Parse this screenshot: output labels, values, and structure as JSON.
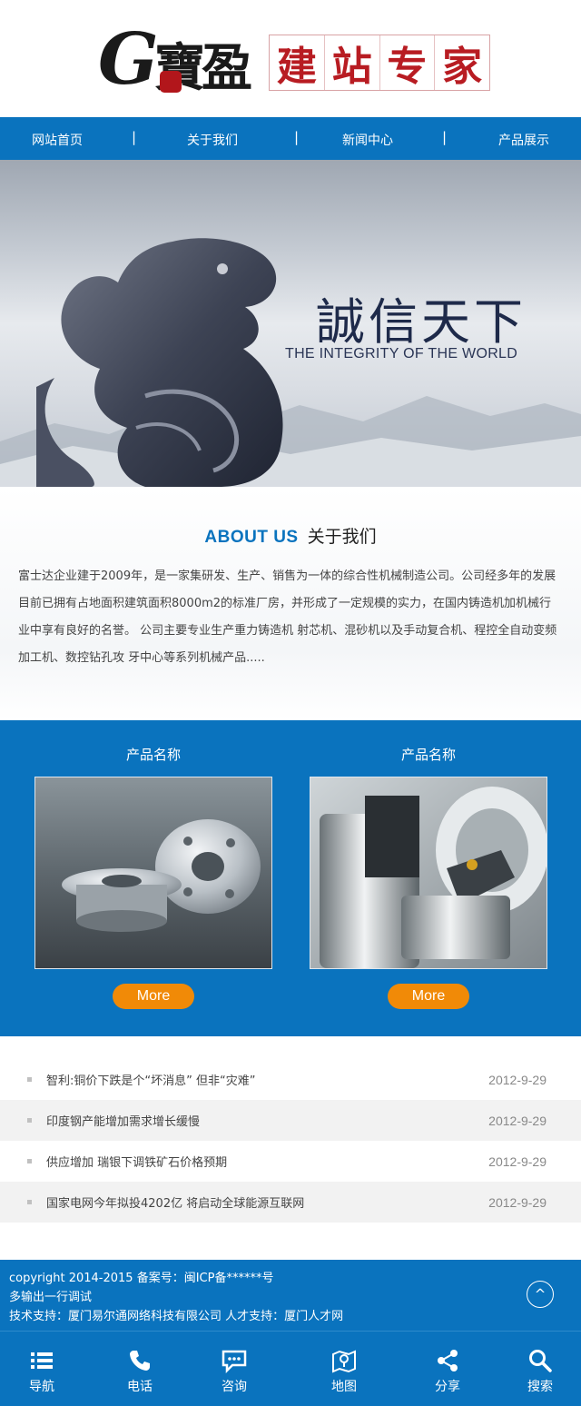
{
  "header": {
    "logo_g": "G",
    "logo_name": "寶盈",
    "logo_slogan_chars": [
      "建",
      "站",
      "专",
      "家"
    ]
  },
  "nav": {
    "items": [
      "网站首页",
      "关于我们",
      "新闻中心",
      "产品展示"
    ],
    "separator": "|"
  },
  "banner": {
    "slogan_zh": "誠信天下",
    "slogan_en": "THE INTEGRITY OF THE WORLD"
  },
  "about": {
    "title_en": "ABOUT US",
    "title_zh": "关于我们",
    "text": "富士达企业建于2009年，是一家集研发、生产、销售为一体的综合性机械制造公司。公司经多年的发展目前已拥有占地面积建筑面积8000m2的标准厂房，并形成了一定规模的实力，在国内铸造机加机械行业中享有良好的名誉。 公司主要专业生产重力铸造机 射芯机、混砂机以及手动复合机、程控全自动变频加工机、数控钻孔攻 牙中心等系列机械产品....."
  },
  "products": [
    {
      "name": "产品名称",
      "more": "More"
    },
    {
      "name": "产品名称",
      "more": "More"
    }
  ],
  "news": [
    {
      "title": "智利:铜价下跌是个“坏消息” 但非“灾难”",
      "date": "2012-9-29"
    },
    {
      "title": "印度钢产能增加需求增长缓慢",
      "date": "2012-9-29"
    },
    {
      "title": "供应增加 瑞银下调铁矿石价格预期",
      "date": "2012-9-29"
    },
    {
      "title": "国家电网今年拟投4202亿 将启动全球能源互联网",
      "date": "2012-9-29"
    }
  ],
  "footer": {
    "line1": "copyright 2014-2015 备案号：闽ICP备******号",
    "line2": "多输出一行调试",
    "line3": "技术支持：厦门易尔通网络科技有限公司 人才支持：厦门人才网",
    "up_icon": "^"
  },
  "tabbar": [
    {
      "label": "导航",
      "icon": "list-icon"
    },
    {
      "label": "电话",
      "icon": "phone-icon"
    },
    {
      "label": "咨询",
      "icon": "chat-icon"
    },
    {
      "label": "地图",
      "icon": "map-icon"
    },
    {
      "label": "分享",
      "icon": "share-icon"
    },
    {
      "label": "搜索",
      "icon": "search-icon"
    }
  ],
  "colors": {
    "brand_blue": "#0a73be",
    "accent_orange": "#f18a07",
    "logo_red": "#b81c22"
  }
}
